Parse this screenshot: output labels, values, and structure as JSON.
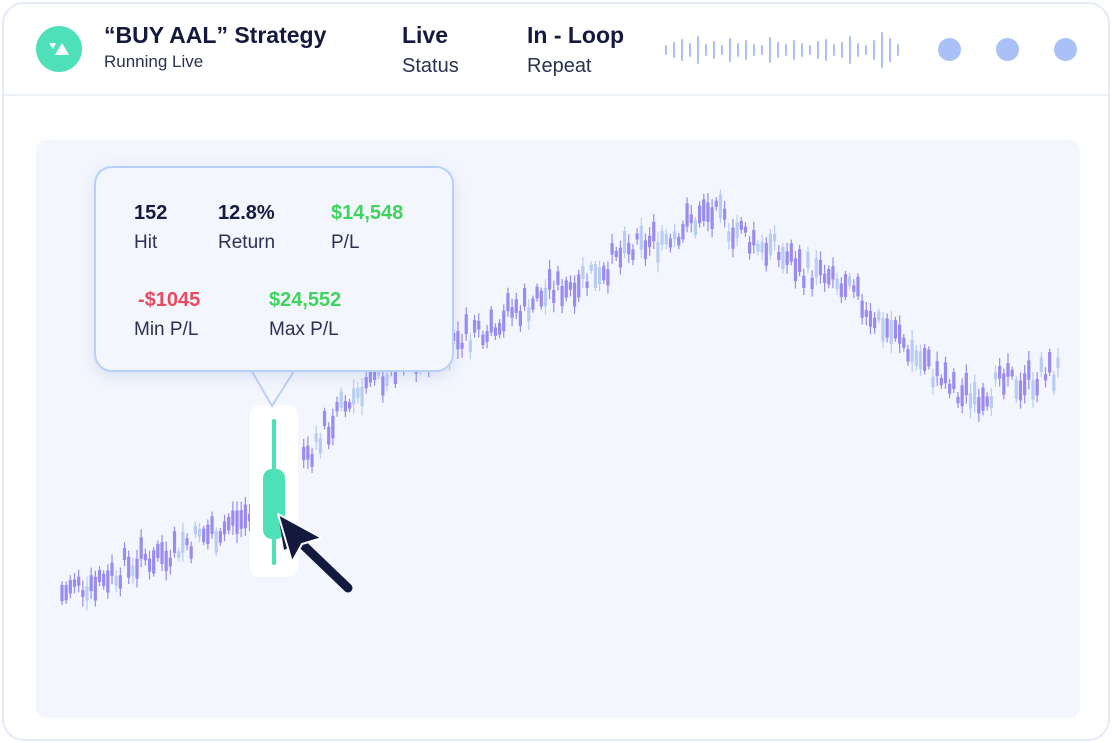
{
  "header": {
    "title": "“BUY AAL” Strategy",
    "subtitle": "Running Live",
    "stats": [
      {
        "value": "Live",
        "label": "Status"
      },
      {
        "value": "In - Loop",
        "label": "Repeat"
      }
    ],
    "icons": [
      "logo-icon",
      "waveform-icon",
      "dot-icon",
      "dot-icon",
      "dot-icon"
    ]
  },
  "tooltip": {
    "row1": [
      {
        "value": "152",
        "label": "Hit",
        "tone": "dark"
      },
      {
        "value": "12.8%",
        "label": "Return",
        "tone": "dark"
      },
      {
        "value": "$14,548",
        "label": "P/L",
        "tone": "positive"
      }
    ],
    "row2": [
      {
        "value": "-$1045",
        "label": "Min P/L",
        "tone": "negative"
      },
      {
        "value": "$24,552",
        "label": "Max P/L",
        "tone": "positive"
      }
    ]
  },
  "colors": {
    "accent": "#4ee0b8",
    "positive": "#3ed45e",
    "negative": "#e84a5f",
    "candle": "#9b8af0",
    "candle_light": "#b9ccf3",
    "dots": "#a9c1f6"
  },
  "chart_data": {
    "type": "candlestick",
    "trend": [
      [
        0,
        0.14
      ],
      [
        0.2,
        0.31
      ],
      [
        0.3,
        0.57
      ],
      [
        0.65,
        0.93
      ],
      [
        0.8,
        0.75
      ],
      [
        0.9,
        0.55
      ],
      [
        1.0,
        0.6
      ]
    ]
  }
}
